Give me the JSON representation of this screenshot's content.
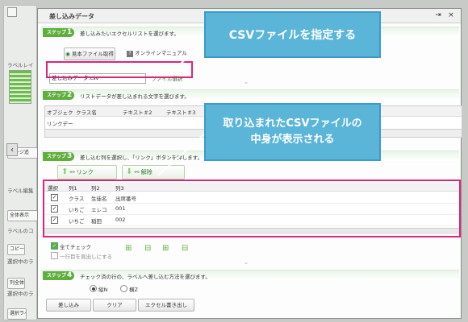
{
  "background_app": {
    "sidebar_labels": [
      "ラベルレイ",
      "ページ追",
      "ラベル編集",
      "全体表示",
      "ラベルのコ",
      "コピー",
      "選択中のラ",
      "選択中のラ"
    ],
    "sidebar_buttons": [
      "列全体",
      "選択ラベル"
    ]
  },
  "dialog": {
    "title": "差し込みデータ",
    "step1": {
      "badge": "ステップ",
      "num": "1",
      "text": "差し込みたいエクセルリストを選びます。",
      "sample_button": "見本ファイル取得",
      "manual_button": "オンラインマニュアル",
      "file_value": "差し込みデータ.csv",
      "file_select_button": "ファイル選択"
    },
    "step2": {
      "badge": "ステップ",
      "num": "2",
      "text": "リストデータが差し込まれる文字を選びます。",
      "headers": [
        "オブジェク",
        "クラス名",
        "テキスト＃2",
        "テキスト＃3"
      ],
      "row1": [
        "リンクデー"
      ]
    },
    "step3": {
      "badge": "ステップ",
      "num": "3",
      "text": "差し込む列を選択し、「リンク」ボタンを押します。",
      "link_button": "リンク",
      "unlink_button": "解除",
      "headers": [
        "選択",
        "列1",
        "列2",
        "列3"
      ],
      "rows": [
        [
          "クラス",
          "生徒名",
          "出席番号"
        ],
        [
          "いちご",
          "エレコ",
          "001"
        ],
        [
          "いちご",
          "稲田",
          "002"
        ]
      ],
      "check_all": "全てチェック",
      "first_row_header": "一行目を見出しにする"
    },
    "step4": {
      "badge": "ステップ",
      "num": "4",
      "text": "チェック済の行の、ラベルへ差し込む方法を選びます。",
      "radio_vertical": "縦N",
      "radio_horizontal": "横Z",
      "insert_button": "差し込み",
      "clear_button": "クリア",
      "export_button": "エクセル書き出し"
    }
  },
  "callouts": {
    "csv_specify": "CSVファイルを指定する",
    "contents_line1": "取り込まれたCSVファイルの",
    "contents_line2": "中身が表示される"
  },
  "colors": {
    "accent_green": "#5fae3e",
    "callout_blue": "#5bb5d9",
    "highlight_magenta": "#e0247a"
  }
}
